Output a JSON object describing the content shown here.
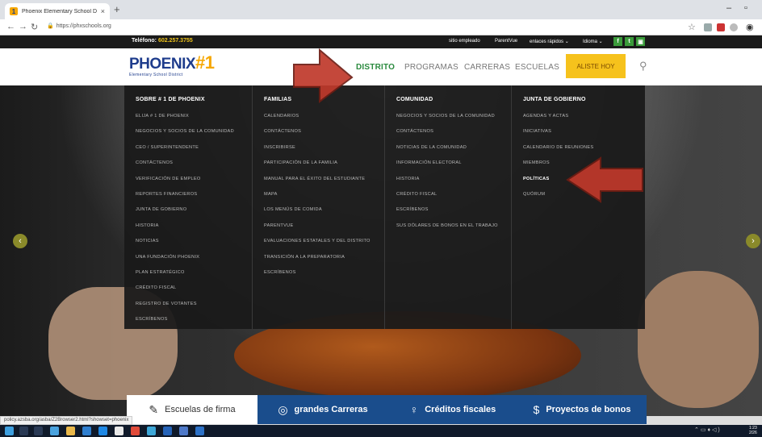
{
  "browser": {
    "tab_title": "Phoenix Elementary School Distri",
    "tab_close": "×",
    "new_tab": "+",
    "url": "https://phxschools.org",
    "status_url": "policy.azsba.org/asba/Z2Browser2.html?showset=phoenix"
  },
  "topbar": {
    "phone_label": "Teléfono:",
    "phone_number": "602.257.3755",
    "links": [
      "sitio empleado",
      "ParentVue",
      "enlaces rápidos ⌄",
      "Idioma ⌄"
    ],
    "social": [
      "f",
      "t",
      "▣"
    ]
  },
  "header": {
    "logo_text": "PHOENIX",
    "logo_mark": "#1",
    "logo_sub": "Elementary School District",
    "nav": [
      "DISTRITO",
      "PROGRAMAS",
      "CARRERAS",
      "ESCUELAS"
    ],
    "cta": "ALISTE HOY"
  },
  "menu": {
    "columns": [
      {
        "head": "SOBRE # 1 DE PHOENIX",
        "items": [
          "ELIJA # 1 DE PHOENIX",
          "NEGOCIOS Y SOCIOS DE LA COMUNIDAD",
          "CEO / SUPERINTENDENTE",
          "CONTÁCTENOS",
          "VERIFICACIÓN DE EMPLEO",
          "REPORTES FINANCIEROS",
          "JUNTA DE GOBIERNO",
          "HISTORIA",
          "NOTICIAS",
          "UNA FUNDACIÓN PHOENIX",
          "PLAN ESTRATÉGICO",
          "CRÉDITO FISCAL",
          "REGISTRO DE VOTANTES",
          "ESCRÍBENOS"
        ]
      },
      {
        "head": "FAMILIAS",
        "items": [
          "CALENDARIOS",
          "CONTÁCTENOS",
          "INSCRIBIRSE",
          "PARTICIPACIÓN DE LA FAMILIA",
          "MANUAL PARA EL ÉXITO DEL ESTUDIANTE",
          "MAPA",
          "LOS MENÚS DE COMIDA",
          "PARENTVUE",
          "EVALUACIONES ESTATALES Y DEL DISTRITO",
          "TRANSICIÓN A LA PREPARATORIA",
          "ESCRÍBENOS"
        ]
      },
      {
        "head": "COMUNIDAD",
        "items": [
          "NEGOCIOS Y SOCIOS DE LA COMUNIDAD",
          "CONTÁCTENOS",
          "NOTICIAS DE LA COMUNIDAD",
          "INFORMACIÓN ELECTORAL",
          "HISTORIA",
          "CRÉDITO FISCAL",
          "ESCRÍBENOS",
          "SUS DÓLARES DE BONOS EN EL TRABAJO"
        ]
      },
      {
        "head": "JUNTA DE GOBIERNO",
        "items": [
          "AGENDAS Y ACTAS",
          "INICIATIVAS",
          "CALENDARIO DE REUNIONES",
          "MIEMBROS",
          "POLÍTICAS",
          "QUÓRUM"
        ]
      }
    ]
  },
  "features": [
    {
      "icon": "✎",
      "label": "Escuelas de firma"
    },
    {
      "icon": "◎",
      "label": "grandes Carreras"
    },
    {
      "icon": "♀",
      "label": "Créditos fiscales"
    },
    {
      "icon": "$",
      "label": "Proyectos de bonos"
    }
  ],
  "taskbar": {
    "time": "1:23",
    "date": "2/26"
  }
}
